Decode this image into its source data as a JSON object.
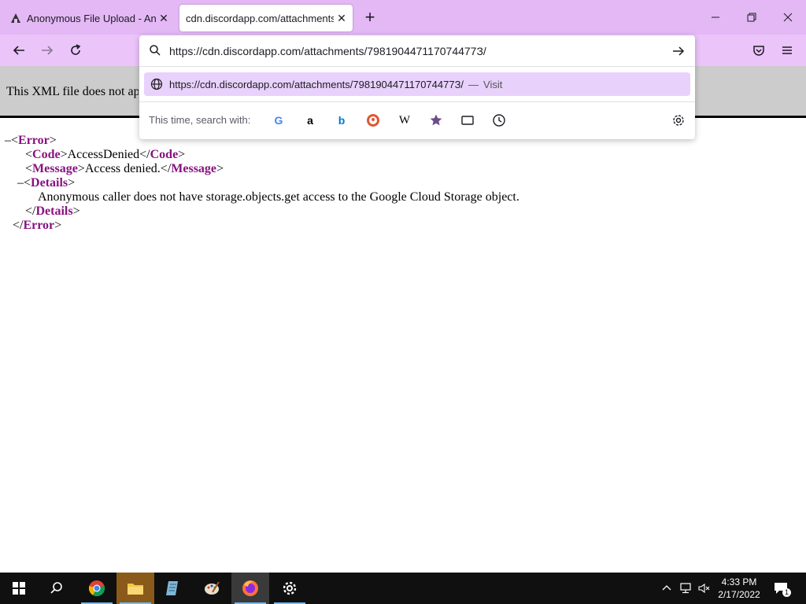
{
  "browser": {
    "tabs": [
      {
        "title": "Anonymous File Upload - Anon",
        "active": false
      },
      {
        "title": "cdn.discordapp.com/attachments/",
        "active": true
      }
    ],
    "url_value": "https://cdn.discordapp.com/attachments/798190447117074477З/",
    "suggestion": {
      "url": "https://cdn.discordapp.com/attachments/798190447117074477З/",
      "separator": "—",
      "action": "Visit"
    },
    "search_with_label": "This time, search with:",
    "engines": [
      "google-icon",
      "amazon-icon",
      "bing-icon",
      "duckduckgo-icon",
      "wikipedia-icon",
      "bookmarks-icon",
      "tabs-icon",
      "history-icon"
    ]
  },
  "page": {
    "xml_notice": "This XML file does not ap",
    "xml": {
      "error_open": "Error",
      "code_tag": "Code",
      "code_value": "AccessDenied",
      "message_tag": "Message",
      "message_value": "Access denied.",
      "details_tag": "Details",
      "details_value": "Anonymous caller does not have storage.objects.get access to the Google Cloud Storage object."
    }
  },
  "taskbar": {
    "time": "4:33 PM",
    "date": "2/17/2022",
    "notification_count": "1"
  },
  "colors": {
    "tabstrip": "#e3b8f5",
    "navbar": "#ebc4fa",
    "suggestion_highlight": "#e8d1fb",
    "xml_tag": "#881280"
  }
}
